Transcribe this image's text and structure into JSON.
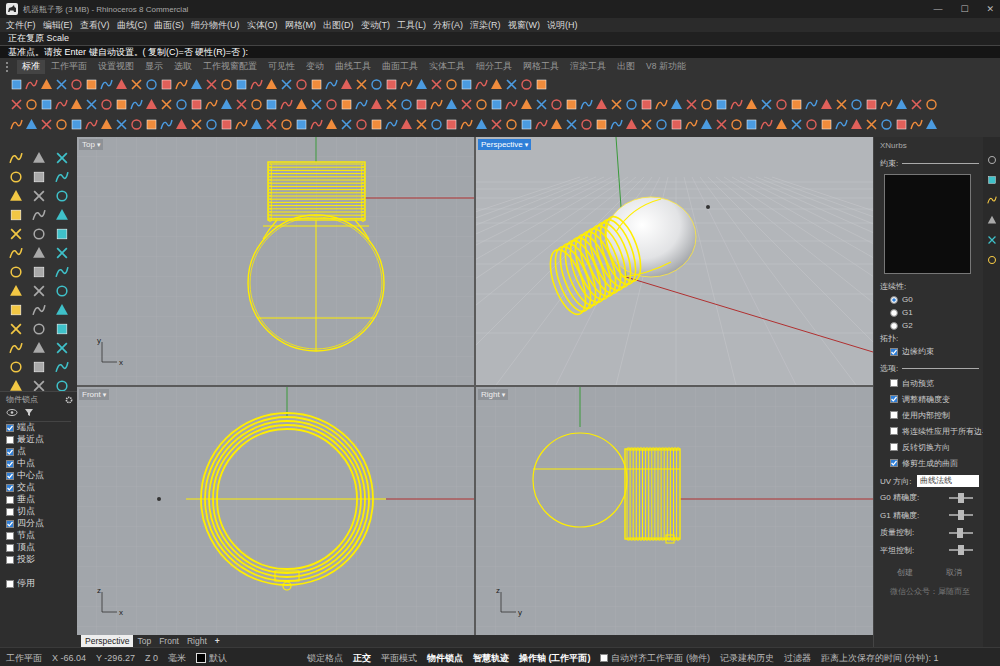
{
  "window": {
    "title": "机器瓶子形 (3 MB) - Rhinoceros 8 Commercial",
    "controls": [
      "—",
      "☐",
      "✕"
    ]
  },
  "menu": [
    "文件(F)",
    "编辑(E)",
    "查看(V)",
    "曲线(C)",
    "曲面(S)",
    "细分物件(U)",
    "实体(O)",
    "网格(M)",
    "出图(D)",
    "变动(T)",
    "工具(L)",
    "分析(A)",
    "渲染(R)",
    "视窗(W)",
    "说明(H)"
  ],
  "command": {
    "history": "正在复原 Scale",
    "prompt": "基准点。请按 Enter 键自动设置。( 复制(C)=否 硬性(R)=否 ):"
  },
  "toolbar_tabs": [
    {
      "label": "标准",
      "selected": true
    },
    {
      "label": "工作平面",
      "selected": false
    },
    {
      "label": "设置视图",
      "selected": false
    },
    {
      "label": "显示",
      "selected": false
    },
    {
      "label": "选取",
      "selected": false
    },
    {
      "label": "工作视窗配置",
      "selected": false
    },
    {
      "label": "可见性",
      "selected": false
    },
    {
      "label": "变动",
      "selected": false
    },
    {
      "label": "曲线工具",
      "selected": false
    },
    {
      "label": "曲面工具",
      "selected": false
    },
    {
      "label": "实体工具",
      "selected": false
    },
    {
      "label": "细分工具",
      "selected": false
    },
    {
      "label": "网格工具",
      "selected": false
    },
    {
      "label": "渲染工具",
      "selected": false
    },
    {
      "label": "出图",
      "selected": false
    },
    {
      "label": "V8 新功能",
      "selected": false
    }
  ],
  "viewports": [
    {
      "title": "Top",
      "kind": "top",
      "active": false,
      "axes": [
        "y",
        "x"
      ]
    },
    {
      "title": "Perspective",
      "kind": "perspective",
      "active": true,
      "axes": []
    },
    {
      "title": "Front",
      "kind": "front",
      "active": false,
      "axes": [
        "z",
        "x"
      ]
    },
    {
      "title": "Right",
      "kind": "right",
      "active": false,
      "axes": [
        "z",
        "y"
      ]
    }
  ],
  "viewport_menu_glyph": "▾",
  "viewport_tabs": [
    {
      "label": "Perspective",
      "selected": true
    },
    {
      "label": "Top",
      "selected": false
    },
    {
      "label": "Front",
      "selected": false
    },
    {
      "label": "Right",
      "selected": false
    }
  ],
  "viewport_add": "+",
  "osnap": {
    "title": "物件锁点",
    "items": [
      {
        "label": "端点",
        "checked": true
      },
      {
        "label": "最近点",
        "checked": false
      },
      {
        "label": "点",
        "checked": true
      },
      {
        "label": "中点",
        "checked": true
      },
      {
        "label": "中心点",
        "checked": true
      },
      {
        "label": "交点",
        "checked": true
      },
      {
        "label": "垂点",
        "checked": false
      },
      {
        "label": "切点",
        "checked": false
      },
      {
        "label": "四分点",
        "checked": true
      },
      {
        "label": "节点",
        "checked": false
      },
      {
        "label": "顶点",
        "checked": false
      },
      {
        "label": "投影",
        "checked": false
      }
    ],
    "disable": {
      "label": "停用",
      "checked": false
    }
  },
  "xnurbs": {
    "title": "XNurbs",
    "constraints_label": "约束:",
    "continuity_label": "连续性:",
    "continuity": [
      {
        "label": "G0",
        "selected": true
      },
      {
        "label": "G1",
        "selected": false
      },
      {
        "label": "G2",
        "selected": false
      }
    ],
    "topology_label": "拓扑:",
    "topology": [
      {
        "label": "边缘约束",
        "checked": true
      }
    ],
    "options_label": "选项:",
    "options": [
      {
        "label": "自动预览",
        "checked": false
      },
      {
        "label": "调整精确度变",
        "checked": true
      },
      {
        "label": "使用内部控制",
        "checked": false
      },
      {
        "label": "将连续性应用于所有边界",
        "checked": false
      },
      {
        "label": "反转切换方向",
        "checked": false
      },
      {
        "label": "修剪生成的曲面",
        "checked": true
      }
    ],
    "uv_label": "UV 方向:",
    "uv_value": "曲线法线",
    "sliders": [
      {
        "label": "G0 精确度:",
        "level": 0.5
      },
      {
        "label": "G1 精确度:",
        "level": 0.5
      },
      {
        "label": "质量控制:",
        "level": 0.45
      },
      {
        "label": "平坦控制:",
        "level": 0.5
      }
    ],
    "buttons": [
      "创建",
      "取消"
    ],
    "footer": "微信公众号：犀随而至"
  },
  "status_bar": {
    "cplane": "工作平面",
    "x": "X -66.04",
    "y": "Y -296.27",
    "z": "Z 0",
    "units": "毫米",
    "layer": {
      "name": "默认",
      "color": "#000000"
    },
    "toggles": [
      {
        "label": "锁定格点",
        "on": false
      },
      {
        "label": "正交",
        "on": true
      },
      {
        "label": "平面模式",
        "on": false
      },
      {
        "label": "物件锁点",
        "on": true
      },
      {
        "label": "智慧轨迹",
        "on": true
      },
      {
        "label": "操作轴 (工作平面)",
        "on": true
      }
    ],
    "auto_align": {
      "label": "自动对齐工作平面 (物件)",
      "checked": false
    },
    "more": [
      {
        "label": "记录建构历史",
        "on": false
      },
      {
        "label": "过滤器",
        "on": false
      }
    ],
    "save_time": "距离上次保存的时间 (分钟): 1"
  }
}
